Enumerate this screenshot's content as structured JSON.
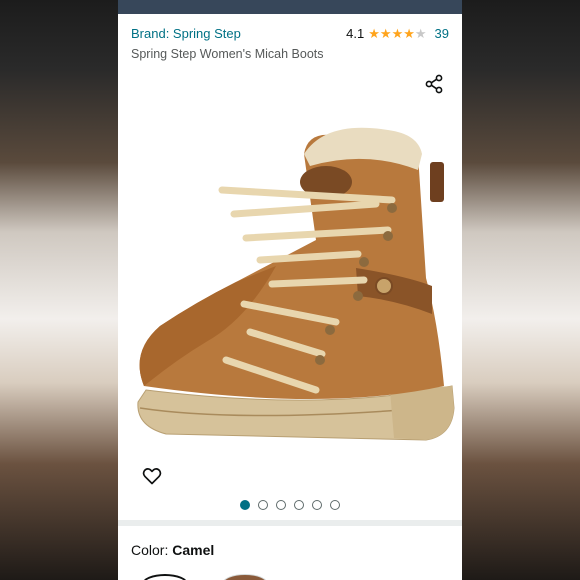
{
  "header": {
    "brand_label": "Brand: Spring Step",
    "title": "Spring Step Women's Micah Boots",
    "rating_value": "4.1",
    "rating_stars": 4.1,
    "rating_count": "39"
  },
  "gallery": {
    "image_count": 6,
    "active_index": 0
  },
  "color": {
    "label": "Color: ",
    "value": "Camel"
  },
  "colors": {
    "link": "#007185",
    "star": "#ffa41c",
    "top_bar": "#37475a"
  },
  "icons": {
    "share": "share-icon",
    "wishlist": "heart-icon"
  }
}
